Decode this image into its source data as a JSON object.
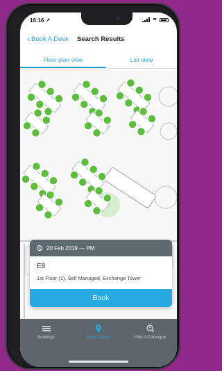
{
  "status_bar": {
    "time": "16:16 ↗"
  },
  "nav": {
    "back_label": "Book A Desk",
    "title": "Search Results"
  },
  "tabs": [
    {
      "label": "Floor plan view",
      "active": true
    },
    {
      "label": "List view",
      "active": false
    }
  ],
  "colors": {
    "accent": "#2aa3dc",
    "desk_available": "#5cbe3c",
    "card_header": "#5f6a70",
    "tab_bar": "#5c666c"
  },
  "card": {
    "date_time": "20 Feb 2019 — PM",
    "desk_code": "E8",
    "location": "1st Floor (1), Self Managed, Exchange Tower",
    "book_label": "Book"
  },
  "tab_bar": {
    "items": [
      {
        "label": "Bookings",
        "icon": "list-icon"
      },
      {
        "label": "Book A Desk",
        "icon": "location-pin-icon",
        "active": true
      },
      {
        "label": "Find A Colleague",
        "icon": "person-search-icon"
      }
    ]
  }
}
